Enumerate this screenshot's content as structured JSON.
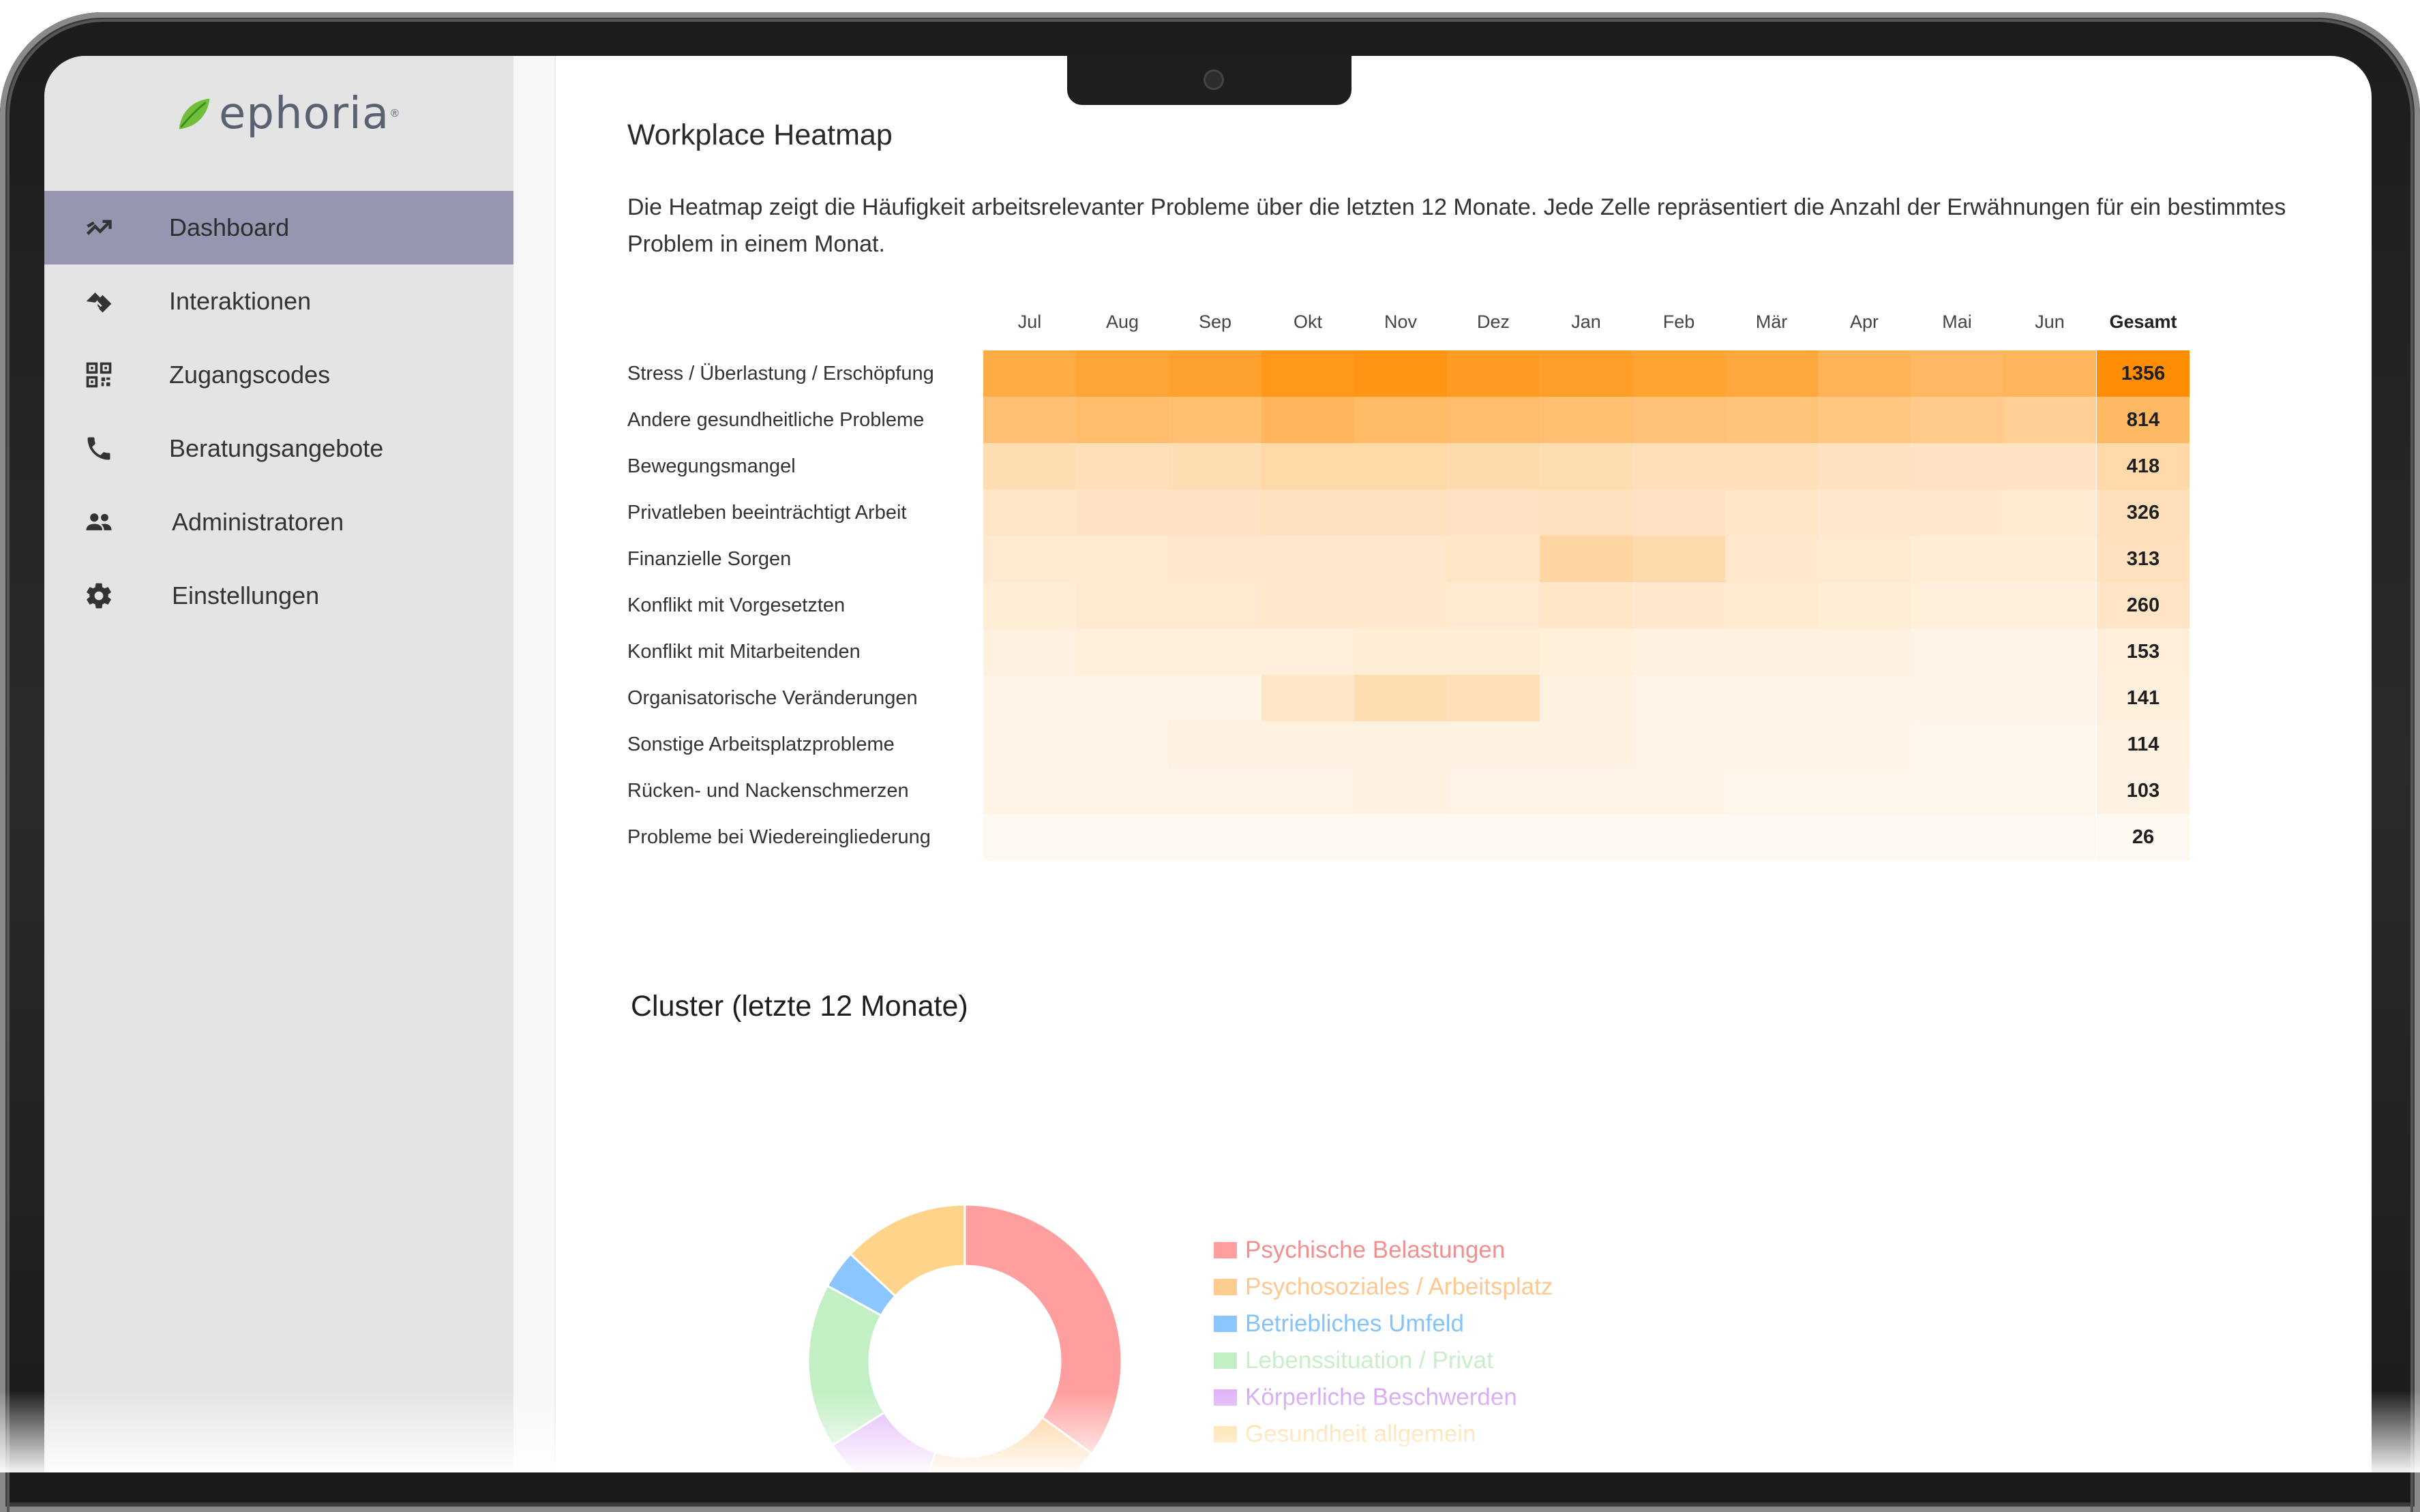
{
  "app": {
    "logo_text": "ephoria",
    "logo_registered": "®"
  },
  "sidebar": {
    "items": [
      {
        "label": "Dashboard",
        "icon": "trending-icon",
        "active": true
      },
      {
        "label": "Interaktionen",
        "icon": "handshake-icon",
        "active": false
      },
      {
        "label": "Zugangscodes",
        "icon": "qr-code-icon",
        "active": false
      },
      {
        "label": "Beratungsangebote",
        "icon": "phone-icon",
        "active": false
      },
      {
        "label": "Administratoren",
        "icon": "people-icon",
        "active": false
      },
      {
        "label": "Einstellungen",
        "icon": "gear-icon",
        "active": false
      }
    ]
  },
  "heatmap": {
    "title": "Workplace Heatmap",
    "description": "Die Heatmap zeigt die Häufigkeit arbeitsrelevanter Probleme über die letzten 12 Monate. Jede Zelle repräsentiert die Anzahl der Erwähnungen für ein bestimmtes Problem in einem Monat.",
    "total_header": "Gesamt",
    "color_base": "#ff8c00"
  },
  "chart_data": [
    {
      "type": "heatmap",
      "title": "Workplace Heatmap",
      "x": [
        "Jul",
        "Aug",
        "Sep",
        "Okt",
        "Nov",
        "Dez",
        "Jan",
        "Feb",
        "Mär",
        "Apr",
        "Mai",
        "Jun"
      ],
      "y": [
        "Stress / Überlastung / Erschöpfung",
        "Andere gesundheitliche Probleme",
        "Bewegungsmangel",
        "Privatleben beeinträchtigt Arbeit",
        "Finanzielle Sorgen",
        "Konflikt mit Vorgesetzten",
        "Konflikt mit Mitarbeitenden",
        "Organisatorische Veränderungen",
        "Sonstige Arbeitsplatzprobleme",
        "Rücken- und Nackenschmerzen",
        "Probleme bei Wiedereingliederung"
      ],
      "intensity": [
        [
          0.72,
          0.78,
          0.82,
          0.9,
          0.92,
          0.86,
          0.84,
          0.8,
          0.76,
          0.66,
          0.62,
          0.64
        ],
        [
          0.55,
          0.58,
          0.56,
          0.64,
          0.6,
          0.58,
          0.56,
          0.54,
          0.52,
          0.5,
          0.46,
          0.42
        ],
        [
          0.3,
          0.28,
          0.3,
          0.34,
          0.34,
          0.32,
          0.3,
          0.28,
          0.28,
          0.26,
          0.24,
          0.24
        ],
        [
          0.22,
          0.24,
          0.24,
          0.26,
          0.26,
          0.24,
          0.26,
          0.24,
          0.22,
          0.2,
          0.2,
          0.18
        ],
        [
          0.18,
          0.18,
          0.2,
          0.2,
          0.2,
          0.22,
          0.36,
          0.32,
          0.2,
          0.18,
          0.16,
          0.16
        ],
        [
          0.16,
          0.18,
          0.18,
          0.2,
          0.2,
          0.18,
          0.22,
          0.2,
          0.18,
          0.16,
          0.14,
          0.14
        ],
        [
          0.12,
          0.14,
          0.14,
          0.14,
          0.16,
          0.16,
          0.14,
          0.12,
          0.12,
          0.12,
          0.1,
          0.1
        ],
        [
          0.1,
          0.1,
          0.1,
          0.22,
          0.3,
          0.28,
          0.12,
          0.1,
          0.1,
          0.1,
          0.1,
          0.1
        ],
        [
          0.1,
          0.1,
          0.12,
          0.12,
          0.12,
          0.12,
          0.12,
          0.1,
          0.1,
          0.1,
          0.08,
          0.08
        ],
        [
          0.1,
          0.1,
          0.1,
          0.1,
          0.12,
          0.1,
          0.1,
          0.1,
          0.08,
          0.08,
          0.08,
          0.08
        ],
        [
          0.06,
          0.06,
          0.06,
          0.06,
          0.06,
          0.06,
          0.06,
          0.06,
          0.06,
          0.06,
          0.06,
          0.06
        ]
      ],
      "totals": [
        1356,
        814,
        418,
        326,
        313,
        260,
        153,
        141,
        114,
        103,
        26
      ],
      "total_label": "Gesamt"
    },
    {
      "type": "pie",
      "title": "Cluster (letzte 12 Monate)",
      "donut": true,
      "labels": [
        "Psychische Belastungen",
        "Psychosoziales / Arbeitsplatz",
        "Betriebliches Umfeld",
        "Lebenssituation / Privat",
        "Körperliche Beschwerden",
        "Gesundheit allgemein"
      ],
      "values": [
        35,
        20,
        4,
        17,
        11,
        13
      ],
      "colors": [
        "#ff9e9e",
        "#ffcc8f",
        "#8cc6ff",
        "#c3efc4",
        "#e1b4fa",
        "#ffd48a"
      ],
      "legend_colors": [
        "#ff9e9e",
        "#ffcc8f",
        "#8cc6ff",
        "#c3efc4",
        "#e1b4fa",
        "#ffd48a"
      ],
      "legend_text_colors": [
        "#f28f8f",
        "#ffc890",
        "#86c3fb",
        "#c8efc9",
        "#d7a8f5",
        "#ffcf88"
      ],
      "segment_order": [
        0,
        1,
        4,
        3,
        2,
        5
      ]
    }
  ]
}
